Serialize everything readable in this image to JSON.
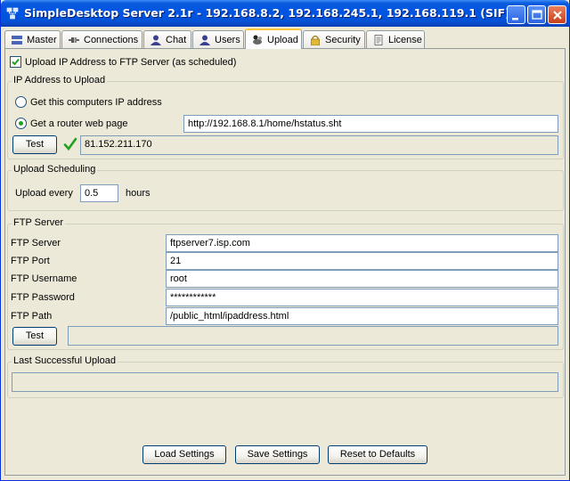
{
  "window": {
    "title": "SimpleDesktop Server 2.1r - 192.168.8.2, 192.168.245.1, 192.168.119.1 (SIF)"
  },
  "tabs": [
    {
      "label": "Master"
    },
    {
      "label": "Connections"
    },
    {
      "label": "Chat"
    },
    {
      "label": "Users"
    },
    {
      "label": "Upload"
    },
    {
      "label": "Security"
    },
    {
      "label": "License"
    }
  ],
  "active_tab": "Upload",
  "upload_checkbox": {
    "label": "Upload IP Address to FTP Server (as scheduled)",
    "checked": true
  },
  "ip_section": {
    "title": "IP Address to Upload",
    "option_local": "Get this computers IP address",
    "option_router": "Get a router web page",
    "selected": "router",
    "router_url": "http://192.168.8.1/home/hstatus.sht",
    "test_label": "Test",
    "result": "81.152.211.170"
  },
  "schedule_section": {
    "title": "Upload Scheduling",
    "label_before": "Upload every",
    "value": "0.5",
    "label_after": "hours"
  },
  "ftp_section": {
    "title": "FTP Server",
    "fields": [
      {
        "label": "FTP Server",
        "value": "ftpserver7.isp.com"
      },
      {
        "label": "FTP Port",
        "value": "21"
      },
      {
        "label": "FTP Username",
        "value": "root"
      },
      {
        "label": "FTP Password",
        "value": "************"
      },
      {
        "label": "FTP Path",
        "value": "/public_html/ipaddress.html"
      }
    ],
    "test_label": "Test",
    "test_result": ""
  },
  "last_upload": {
    "title": "Last Successful Upload",
    "value": ""
  },
  "buttons": {
    "load": "Load Settings",
    "save": "Save Settings",
    "reset": "Reset to Defaults"
  },
  "colors": {
    "titlebar": "#0054e3",
    "accent_tab": "#ffc83c",
    "check": "#21a121"
  }
}
